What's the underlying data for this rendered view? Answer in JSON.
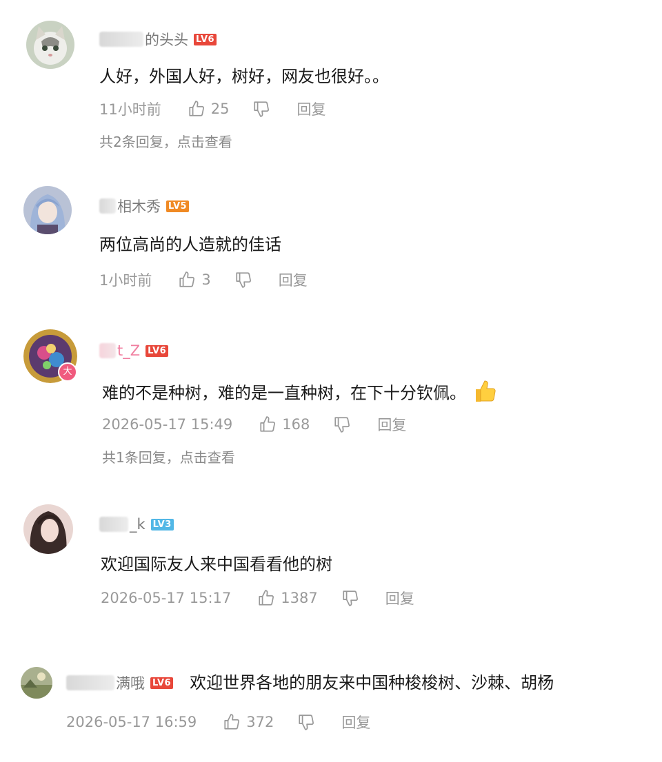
{
  "colors": {
    "lv6": "#e8473a",
    "lv5": "#f08a24",
    "lv3": "#52b7e6",
    "meta": "#999999",
    "text": "#1a1a1a"
  },
  "comments": [
    {
      "name_visible": "的头头",
      "level": "LV6",
      "text": "人好，外国人好，树好，网友也很好。。",
      "time": "11小时前",
      "likes": "25",
      "reply_label": "回复",
      "replies": "共2条回复，点击查看",
      "avatar_icon": "cat-avatar-icon"
    },
    {
      "name_visible": "相木秀",
      "level": "LV5",
      "text": "两位高尚的人造就的佳话",
      "time": "1小时前",
      "likes": "3",
      "reply_label": "回复",
      "avatar_icon": "anime-girl-avatar-icon"
    },
    {
      "name_visible": "t_Z",
      "level": "LV6",
      "text": "难的不是种树，难的是一直种树，在下十分钦佩。",
      "emoji": "thumbs-up-emoji",
      "time": "2026-05-17 15:49",
      "likes": "168",
      "reply_label": "回复",
      "replies": "共1条回复，点击查看",
      "avatar_icon": "colorful-avatar-icon",
      "badge": "大"
    },
    {
      "name_visible": "_k",
      "level": "LV3",
      "text": "欢迎国际友人来中国看看他的树",
      "time": "2026-05-17 15:17",
      "likes": "1387",
      "reply_label": "回复",
      "avatar_icon": "woman-photo-avatar-icon"
    },
    {
      "name_visible": "满哦",
      "level": "LV6",
      "text": "欢迎世界各地的朋友来中国种梭梭树、沙棘、胡杨",
      "time": "2026-05-17 16:59",
      "likes": "372",
      "reply_label": "回复",
      "avatar_icon": "landscape-avatar-icon"
    }
  ]
}
